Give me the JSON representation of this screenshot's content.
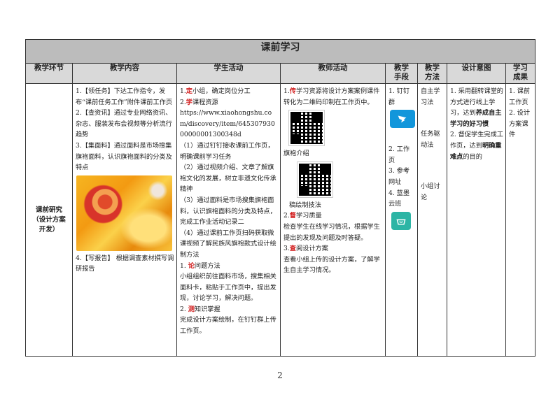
{
  "table_title": "课前学习",
  "headers": {
    "stage": "教学环节",
    "content": "教学内容",
    "student": "学生活动",
    "teacher": "教师活动",
    "means_1": "教学",
    "means_2": "手段",
    "method_1": "教学",
    "method_2": "方法",
    "intent": "设计意图",
    "outcome_1": "学习",
    "outcome_2": "成果"
  },
  "stage": {
    "line1": "课前研究",
    "line2": "（设计方案",
    "line3": "开发）"
  },
  "content": {
    "item1": "1.【领任务】下达工作指令，发布“课前任务工作”附件课前工作页",
    "item2": "2.【查资讯】通过专业网络资讯、杂志、服装发布会视频等分析流行趋势",
    "item3": "3.【集面料】通过面料是市场搜集旗袍面料，认识旗袍面料的分类及特点",
    "item4": "4.【写报告】 根据调查素材撰写调研报告"
  },
  "student": {
    "s1_num": "1.",
    "s1_key": "定",
    "s1_rest": "小组，确定岗位分工",
    "s2_num": "2.",
    "s2_key": "学",
    "s2_rest": "课程资源",
    "url": "https://www.xiaohongshu.com/discovery/item/64530793000000001300348d",
    "p1": "（1）通过钉钉接收课前工作页，明确课前学习任务",
    "p2": "（2）通过视频介绍、文章了解旗袍文化的发展，树立非遗文化传承精神",
    "p3": "（3）通过面料是市场搜集旗袍面料，认识旗袍面料的分类及特点，完成工作业活动记录二",
    "p4": "（4）通过课前工作页扫码获取微课视频了解民族风旗袍款式设计绘制方法",
    "q1_num": "1.",
    "q1_key": "论",
    "q1_rest": "问题方法",
    "q1_text": "小组组织前往面料市场，搜集相关面料卡，粘贴于工作页中，提出发现，讨论学习，解决问题。",
    "q2_num": "2.",
    "q2_key": "测",
    "q2_rest": "知识掌握",
    "q2_text": "完成设计方案绘制，在钉钉群上传工作页。"
  },
  "teacher": {
    "t1_num": "1.",
    "t1_key": "传",
    "t1_rest": "学习资源将设计方案案例课件转化为二维码印制在工作页中。",
    "qr1_caption": "旗袍介绍",
    "qr2_caption": "稿绘制技法",
    "t2_num": "2.",
    "t2_key": "督",
    "t2_rest": "学习质量",
    "t2_text": "检查学生在线学习情况，根据学生提出的发现及问题及时答疑。",
    "t3_num": "3.",
    "t3_key": "查",
    "t3_rest": "阅设计方案",
    "t3_text": "查看小组上传的设计方案，了解学生自主学习情况。"
  },
  "means": {
    "m1": "1. 钉钉群",
    "m2": "2. 工作页",
    "m3": "3. 参考网址",
    "m4": "4. 蓝墨云班"
  },
  "method": {
    "a": "自主学习法",
    "b": "任务驱动法",
    "c": "小组讨论"
  },
  "intent": {
    "i1_pre": "1. 采用翻转课堂的方式进行线上学习，达到",
    "i1_bold": "养成自主学习的好习惯",
    "i2_pre": "2. 督促学生完成工作页，达到",
    "i2_bold": "明确重难点",
    "i2_post": "的目的"
  },
  "outcome": {
    "o1": "1. 课前工作页",
    "o2": "2. 设计方案课件"
  },
  "page_number": "2",
  "colors": {
    "accent_red": "#d21f1f",
    "header_gray": "#d9d9d9",
    "title_gray": "#bcbcbc"
  },
  "icons": [
    "dingtalk-icon",
    "lanmo-cloud-icon",
    "qr-code"
  ]
}
